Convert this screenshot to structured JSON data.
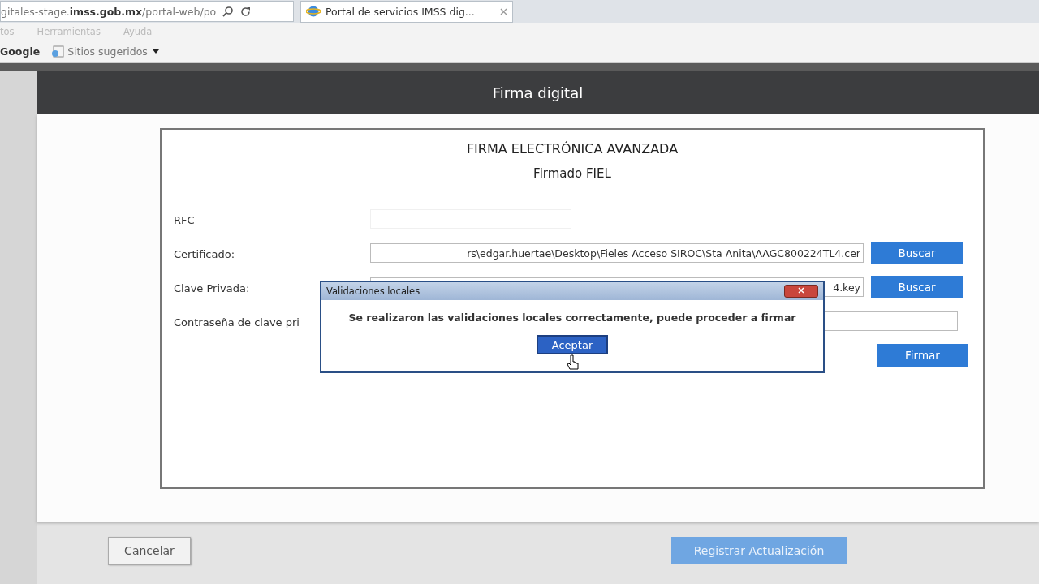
{
  "browser": {
    "address": "gitales-stage.**imss.gob.mx**/portal-web/po",
    "tab": {
      "title": "Portal de servicios IMSS dig...",
      "selected": true
    },
    "menu": [
      "tos",
      "Herramientas",
      "Ayuda"
    ],
    "favorites": [
      "Google",
      "Sitios sugeridos"
    ]
  },
  "header": {
    "title": "Firma digital"
  },
  "form": {
    "title": "FIRMA ELECTRÓNICA AVANZADA",
    "subtitle": "Firmado FIEL",
    "fields": [
      {
        "label": "RFC",
        "kind": "text"
      },
      {
        "label": "Certificado:",
        "kind": "file",
        "value": "rs\\edgar.huertae\\Desktop\\Fieles Acceso SIROC\\Sta Anita\\AAGC800224TL4.cer",
        "button": "Buscar"
      },
      {
        "label": "Clave Privada:",
        "kind": "file",
        "value": "4.key",
        "button": "Buscar"
      },
      {
        "label": "Contraseña de clave pri",
        "kind": "password"
      }
    ],
    "submit": "Firmar"
  },
  "dialog": {
    "title": "Validaciones locales",
    "message": "Se realizaron las validaciones locales correctamente, puede proceder a firmar",
    "button": "Aceptar"
  },
  "footer": {
    "cancel": "Cancelar",
    "submit": "Registrar Actualización"
  }
}
